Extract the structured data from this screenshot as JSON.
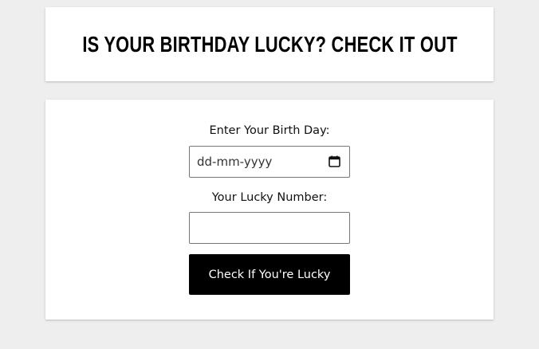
{
  "header": {
    "title": "Is Your Birthday Lucky? Check It Out"
  },
  "form": {
    "birthday_label": "Enter Your Birth Day:",
    "birthday_placeholder": "dd-mm-yyyy",
    "lucky_label": "Your Lucky Number:",
    "lucky_value": "",
    "check_button_label": "Check If You're Lucky"
  },
  "icons": {
    "calendar": "calendar-icon"
  },
  "colors": {
    "page_background": "#eeeeee",
    "card_background": "#ffffff",
    "button_background": "#000000",
    "button_text": "#ffffff"
  }
}
